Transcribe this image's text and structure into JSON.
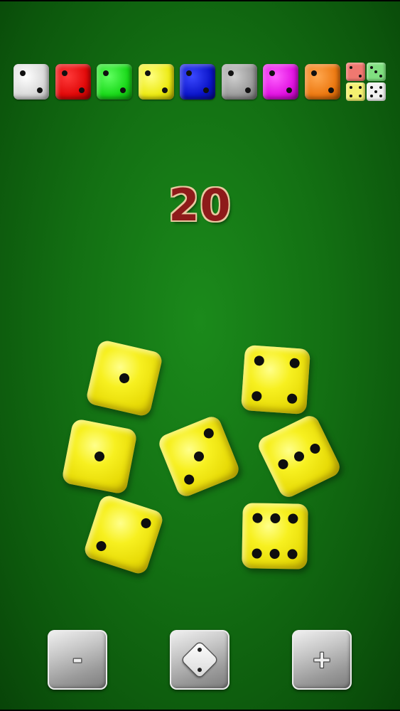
{
  "palette": {
    "colors": [
      {
        "name": "white",
        "hex": "#e6e6e6"
      },
      {
        "name": "red",
        "hex": "#e00808"
      },
      {
        "name": "green",
        "hex": "#18d818"
      },
      {
        "name": "yellow",
        "hex": "#ecea10"
      },
      {
        "name": "blue",
        "hex": "#0a14c8"
      },
      {
        "name": "gray",
        "hex": "#9a9a9a"
      },
      {
        "name": "magenta",
        "hex": "#e010e0"
      },
      {
        "name": "orange",
        "hex": "#ec7810"
      }
    ],
    "mixed": {
      "name": "multicolor",
      "hexes": [
        "#f07870",
        "#80e080",
        "#f4f070",
        "#f2f2f2"
      ]
    }
  },
  "score": "20",
  "dice": {
    "color": "#ecea10",
    "values": [
      1,
      4,
      1,
      3,
      3,
      2,
      6
    ]
  },
  "controls": {
    "minus": "-",
    "plus": "+",
    "roll_icon": "die-icon"
  },
  "colors": {
    "felt": "#137013",
    "score_fill": "#8e1a1a",
    "score_outline": "#e8c9a0"
  }
}
